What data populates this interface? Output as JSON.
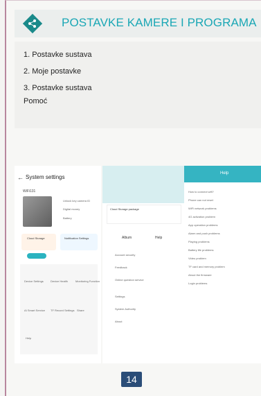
{
  "header": {
    "title": "POSTAVKE KAMERE I PROGRAMA",
    "icon": "share-icon",
    "accent": "#1aa7b5"
  },
  "items": [
    "1. Postavke sustava",
    "2. Moje postavke",
    "3. Postavke sustava",
    "Pomoć"
  ],
  "page_number": "14",
  "screens": {
    "system_settings": {
      "title": "System settings",
      "device_name": "WiFi131",
      "toggles": [
        "Unlock key camera ID",
        "Digital money",
        "Battery"
      ],
      "cloud_storage": "Cloud Storage",
      "notification_settings": "Notification Settings",
      "tiles": [
        "Device Settings",
        "Device Health",
        "Monitoring Function",
        "AI Smart Service",
        "TF Record Settings",
        "Share",
        "Help"
      ]
    },
    "my_settings": {
      "cloud_storage": "Cloud Storage package",
      "buttons": [
        "Album",
        "Help"
      ],
      "menu": [
        "Account security",
        "Feedback",
        "Online question service",
        "Settings",
        "System Authority",
        "About"
      ]
    },
    "help": {
      "title": "Help",
      "items": [
        "How to connect wifi?",
        "Phone can not reset",
        "WiFi network problems",
        "4G activation problem",
        "App operation problems",
        "Alarm and push problems",
        "Playing problems",
        "Battery life problems",
        "Video problem",
        "TF card and memory problem",
        "About the firmware",
        "Login problems"
      ]
    }
  }
}
